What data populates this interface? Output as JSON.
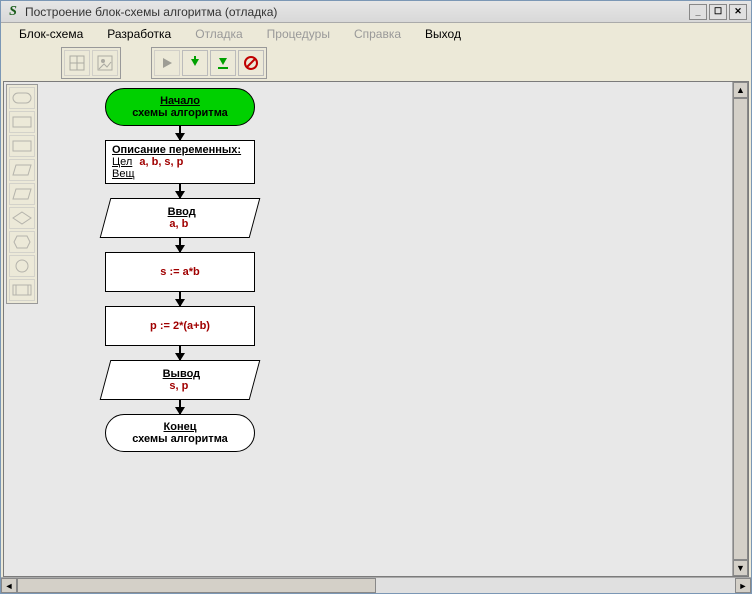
{
  "window": {
    "title": "Построение блок-схемы алгоритма (отладка)"
  },
  "menu": {
    "m0": "Блок-схема",
    "m1": "Разработка",
    "m2": "Отладка",
    "m3": "Процедуры",
    "m4": "Справка",
    "m5": "Выход"
  },
  "flow": {
    "start": {
      "line1": "Начало",
      "line2": "схемы алгоритма"
    },
    "decl": {
      "header": "Описание переменных:",
      "int_label": "Цел",
      "int_vars": "a, b, s, p",
      "real_label": "Вещ"
    },
    "input": {
      "label": "Ввод",
      "vars": "a, b"
    },
    "proc1": {
      "expr": "s := a*b"
    },
    "proc2": {
      "expr": "p := 2*(a+b)"
    },
    "output": {
      "label": "Вывод",
      "vars": "s, p"
    },
    "end": {
      "line1": "Конец",
      "line2": "схемы алгоритма"
    }
  }
}
